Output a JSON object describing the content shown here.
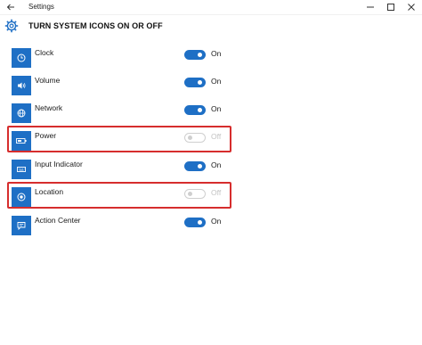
{
  "window": {
    "title": "Settings",
    "controls": [
      "minimize",
      "maximize",
      "close"
    ]
  },
  "page": {
    "title": "TURN SYSTEM ICONS ON OR OFF",
    "icon": "gear-icon"
  },
  "colors": {
    "accent": "#1e6fc5",
    "highlight": "#d62d2d",
    "disabled_text": "#c4c4c4"
  },
  "items": [
    {
      "label": "Clock",
      "icon": "clock-icon",
      "state": "On",
      "on": true,
      "enabled": true,
      "highlighted": false
    },
    {
      "label": "Volume",
      "icon": "volume-icon",
      "state": "On",
      "on": true,
      "enabled": true,
      "highlighted": false
    },
    {
      "label": "Network",
      "icon": "network-icon",
      "state": "On",
      "on": true,
      "enabled": true,
      "highlighted": false
    },
    {
      "label": "Power",
      "icon": "battery-icon",
      "state": "Off",
      "on": false,
      "enabled": false,
      "highlighted": true
    },
    {
      "label": "Input Indicator",
      "icon": "keyboard-icon",
      "state": "On",
      "on": true,
      "enabled": true,
      "highlighted": false
    },
    {
      "label": "Location",
      "icon": "location-icon",
      "state": "Off",
      "on": false,
      "enabled": false,
      "highlighted": true
    },
    {
      "label": "Action Center",
      "icon": "action-center-icon",
      "state": "On",
      "on": true,
      "enabled": true,
      "highlighted": false
    }
  ]
}
